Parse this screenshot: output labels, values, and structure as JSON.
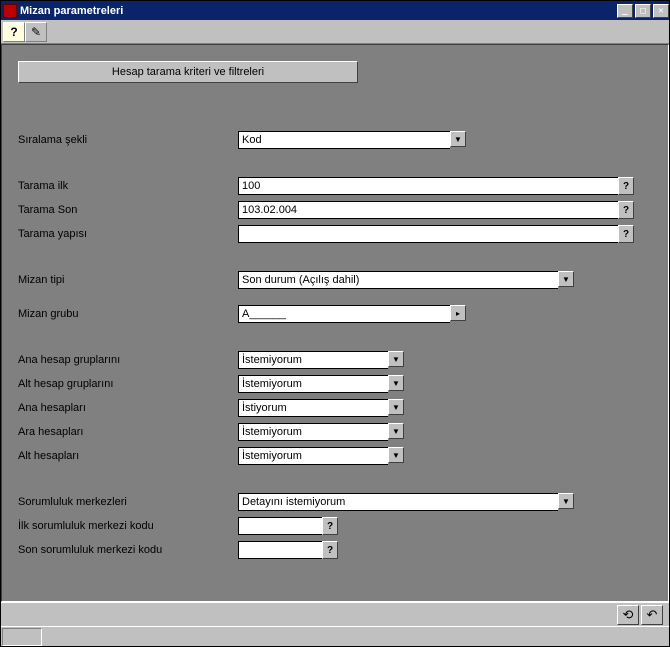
{
  "window": {
    "title": "Mizan parametreleri"
  },
  "toolbar": {
    "help": "?",
    "magic": "≋"
  },
  "main_button": "Hesap tarama kriteri ve filtreleri",
  "fields": {
    "siralama_sekli": {
      "label": "Sıralama şekli",
      "value": "Kod"
    },
    "tarama_ilk": {
      "label": "Tarama ilk",
      "value": "100"
    },
    "tarama_son": {
      "label": "Tarama Son",
      "value": "103.02.004"
    },
    "tarama_yapisi": {
      "label": "Tarama yapısı",
      "value": ""
    },
    "mizan_tipi": {
      "label": "Mizan tipi",
      "value": "Son durum (Açılış dahil)"
    },
    "mizan_grubu": {
      "label": "Mizan grubu",
      "value": "A______"
    },
    "ana_hesap_gruplarini": {
      "label": "Ana hesap gruplarını",
      "value": "İstemiyorum"
    },
    "alt_hesap_gruplarini": {
      "label": "Alt hesap gruplarını",
      "value": "İstemiyorum"
    },
    "ana_hesaplari": {
      "label": "Ana hesapları",
      "value": "İstiyorum"
    },
    "ara_hesaplari": {
      "label": "Ara hesapları",
      "value": "İstemiyorum"
    },
    "alt_hesaplari": {
      "label": "Alt hesapları",
      "value": "İstemiyorum"
    },
    "sorumluluk_merkezleri": {
      "label": "Sorumluluk merkezleri",
      "value": "Detayını istemiyorum"
    },
    "ilk_sorumluluk_merkezi": {
      "label": "İlk sorumluluk merkezi kodu",
      "value": ""
    },
    "son_sorumluluk_merkezi": {
      "label": "Son sorumluluk merkezi kodu",
      "value": ""
    }
  }
}
